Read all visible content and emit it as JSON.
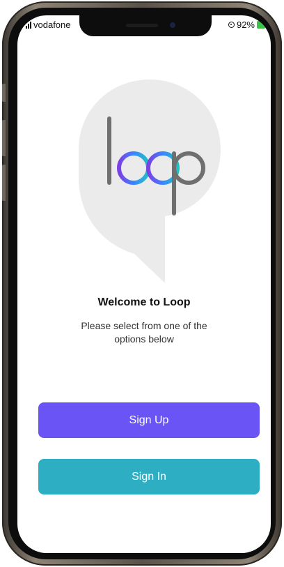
{
  "status_bar": {
    "carrier": "vodafone",
    "battery": "92%"
  },
  "logo": {
    "text": "loop",
    "accent_colors": [
      "#7b3fe4",
      "#3a86ff",
      "#22c1c3"
    ]
  },
  "welcome": {
    "title": "Welcome to Loop",
    "subtitle": "Please select from one of the options below"
  },
  "buttons": {
    "sign_up": {
      "label": "Sign Up",
      "color": "#6a54f5"
    },
    "sign_in": {
      "label": "Sign In",
      "color": "#2eaec3"
    }
  }
}
